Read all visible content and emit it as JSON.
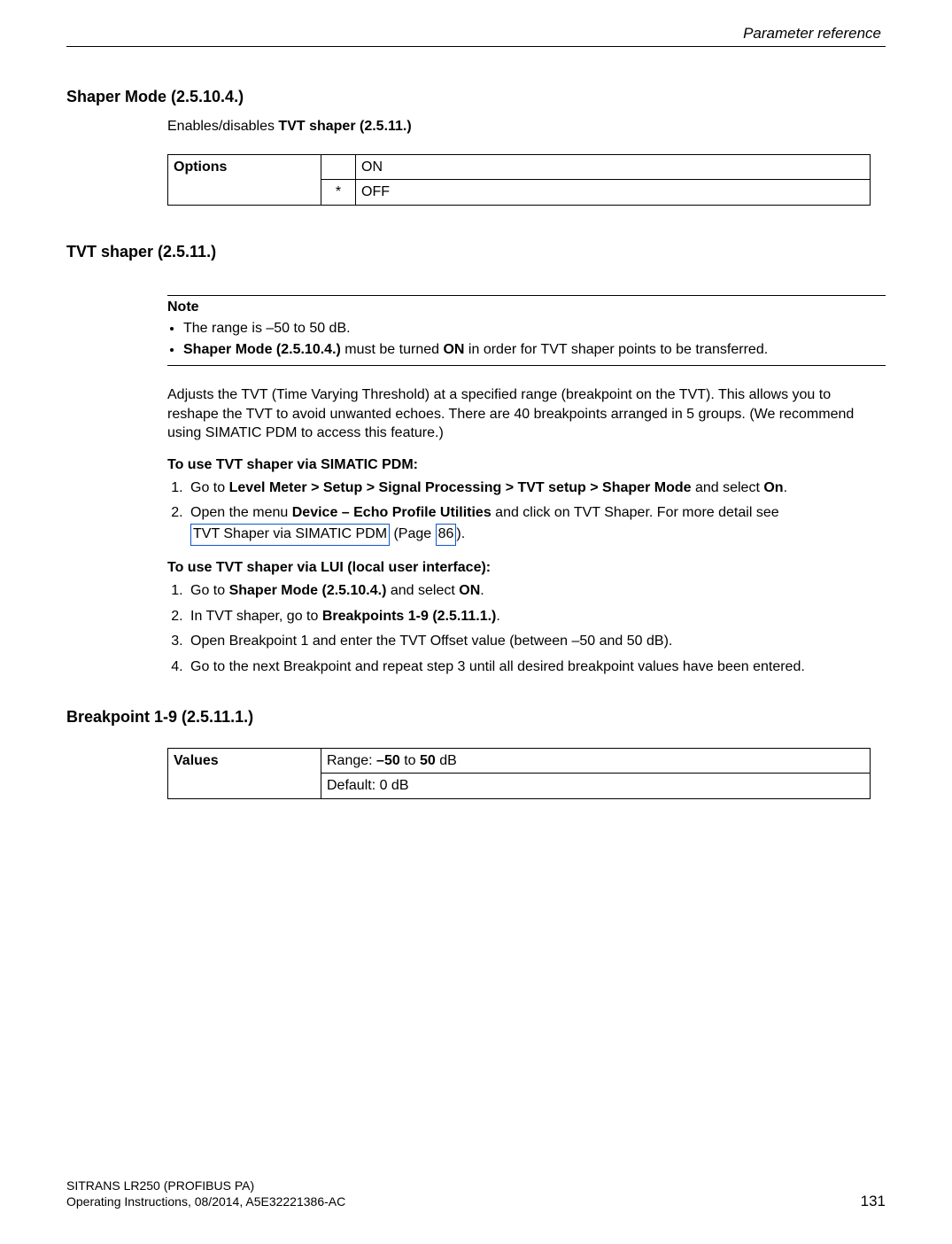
{
  "header": {
    "section": "Parameter reference"
  },
  "shaper_mode": {
    "heading": "Shaper Mode (2.5.10.4.)",
    "desc_prefix": "Enables/disables ",
    "desc_bold": "TVT shaper (2.5.11.)",
    "table": {
      "label": "Options",
      "row1_mark": " ",
      "row1_val": "ON",
      "row2_mark": "*",
      "row2_val": "OFF"
    }
  },
  "tvt_shaper": {
    "heading": "TVT shaper (2.5.11.)",
    "note_label": "Note",
    "note_bullet1": "The range is –50 to 50 dB.",
    "note_bullet2_b1": "Shaper Mode (2.5.10.4.)",
    "note_bullet2_mid": " must be turned ",
    "note_bullet2_b2": "ON",
    "note_bullet2_tail": " in order for TVT shaper points to be transferred.",
    "body_para": "Adjusts the TVT (Time Varying Threshold) at a specified range (breakpoint on the TVT). This allows you to reshape the TVT to avoid unwanted echoes. There are 40 breakpoints arranged in 5 groups. (We recommend using SIMATIC PDM to access this feature.)",
    "pdm_heading": "To use TVT shaper via SIMATIC PDM:",
    "pdm_step1_pre": "Go to ",
    "pdm_step1_bold": "Level Meter > Setup > Signal Processing > TVT setup > Shaper Mode",
    "pdm_step1_mid": " and select ",
    "pdm_step1_bold2": "On",
    "pdm_step1_tail": ".",
    "pdm_step2_pre": "Open the menu ",
    "pdm_step2_bold": "Device – Echo Profile Utilities",
    "pdm_step2_mid": " and click on TVT Shaper. For more detail see ",
    "pdm_step2_link1": "TVT Shaper via SIMATIC PDM",
    "pdm_step2_between": " (Page ",
    "pdm_step2_link2": "86",
    "pdm_step2_tail": ").",
    "lui_heading": "To use TVT shaper via LUI (local user interface):",
    "lui_step1_pre": "Go to ",
    "lui_step1_bold": "Shaper Mode (2.5.10.4.)",
    "lui_step1_mid": " and select ",
    "lui_step1_bold2": "ON",
    "lui_step1_tail": ".",
    "lui_step2_pre": "In TVT shaper, go to ",
    "lui_step2_bold": "Breakpoints 1-9 (2.5.11.1.)",
    "lui_step2_tail": ".",
    "lui_step3": "Open Breakpoint 1 and enter the TVT Offset value (between –50 and 50 dB).",
    "lui_step4": "Go to the next Breakpoint and repeat step 3 until all desired breakpoint values have been entered."
  },
  "breakpoint": {
    "heading": "Breakpoint 1-9 (2.5.11.1.)",
    "table": {
      "label": "Values",
      "row1_pre": "Range: ",
      "row1_b1": "–50",
      "row1_mid": " to ",
      "row1_b2": "50",
      "row1_tail": " dB",
      "row2": "Default: 0 dB"
    }
  },
  "footer": {
    "line1": "SITRANS LR250 (PROFIBUS PA)",
    "line2": "Operating Instructions, 08/2014, A5E32221386-AC",
    "page": "131"
  }
}
